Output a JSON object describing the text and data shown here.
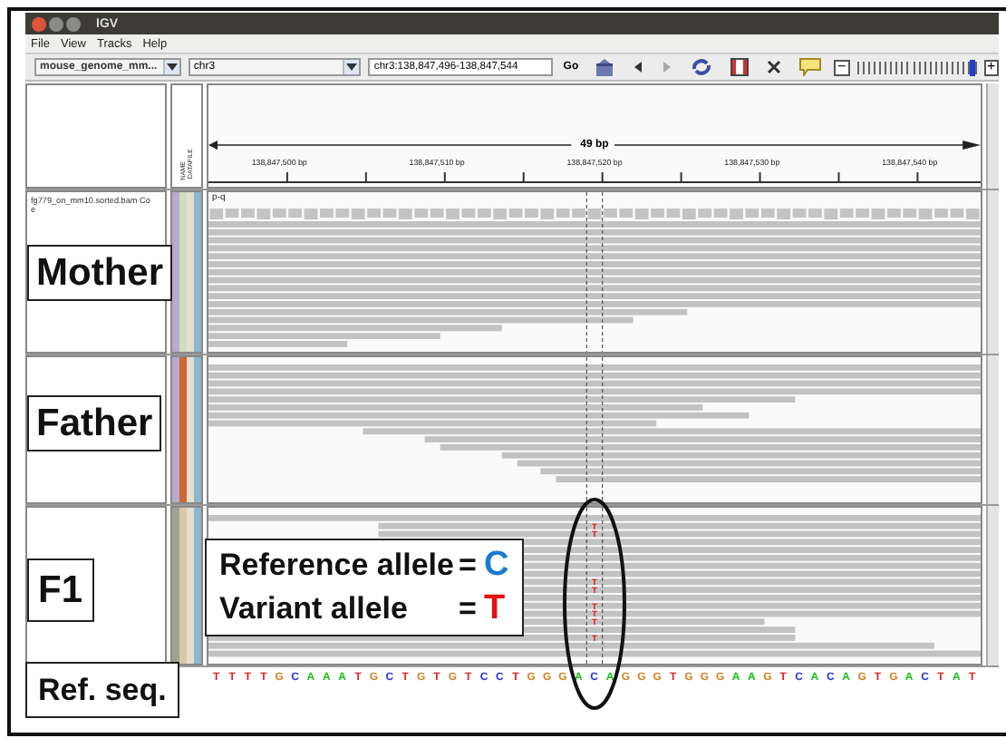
{
  "window": {
    "title": "IGV"
  },
  "menu": [
    "File",
    "View",
    "Tracks",
    "Help"
  ],
  "toolbar": {
    "genome": "mouse_genome_mm...",
    "chromosome": "chr3",
    "locus": "chr3:138,847,496-138,847,544",
    "go": "Go",
    "zoom": {
      "minus": "−",
      "plus": "+",
      "level": 0.97
    }
  },
  "ruler": {
    "span": "49 bp",
    "ticks": [
      "138,847,500 bp",
      "138,847,510 bp",
      "138,847,520 bp",
      "138,847,530 bp",
      "138,847,540 bp"
    ]
  },
  "attribute_headers": [
    "NAME",
    "DATAFILE"
  ],
  "panels": [
    {
      "kind": "mother",
      "label": "Mother",
      "track_name": "fg779_on_mm10.sorted.bam Co",
      "track_name_line_2": "e",
      "band": "p-q",
      "attributes": [
        {
          "color": "#b7a9cf"
        },
        {
          "color": "#cfdcbf"
        },
        {
          "color": "#e6dfcf"
        },
        {
          "color": "#8db7cb"
        }
      ]
    },
    {
      "kind": "father",
      "label": "Father",
      "attributes": [
        {
          "color": "#b7a9cf"
        },
        {
          "color": "#cc6633"
        },
        {
          "color": "#e6dfcf"
        },
        {
          "color": "#8db7cb"
        }
      ]
    },
    {
      "kind": "f1",
      "label": "F1",
      "attributes": [
        {
          "color": "#9ea293"
        },
        {
          "color": "#d9c8a6"
        },
        {
          "color": "#e6dfcf"
        },
        {
          "color": "#8db7cb"
        }
      ],
      "mismatches": [
        "T",
        "T",
        "T",
        "T",
        "T",
        "T",
        "T",
        "T"
      ]
    }
  ],
  "legend": [
    {
      "label": "Reference allele",
      "equals": "=",
      "base": "C",
      "color": "#1a7bd0"
    },
    {
      "label": "Variant allele",
      "equals": "=",
      "base": "T",
      "color": "#e81010"
    }
  ],
  "reference": {
    "label": "Ref. seq.",
    "bases": [
      {
        "base": "T",
        "color": "#e02020"
      },
      {
        "base": "T",
        "color": "#e02020"
      },
      {
        "base": "T",
        "color": "#e02020"
      },
      {
        "base": "T",
        "color": "#e02020"
      },
      {
        "base": "G",
        "color": "#d08020"
      },
      {
        "base": "C",
        "color": "#2030e0"
      },
      {
        "base": "A",
        "color": "#20c020"
      },
      {
        "base": "A",
        "color": "#20c020"
      },
      {
        "base": "A",
        "color": "#20c020"
      },
      {
        "base": "T",
        "color": "#e02020"
      },
      {
        "base": "G",
        "color": "#d08020"
      },
      {
        "base": "C",
        "color": "#2030e0"
      },
      {
        "base": "T",
        "color": "#e02020"
      },
      {
        "base": "G",
        "color": "#d08020"
      },
      {
        "base": "T",
        "color": "#e02020"
      },
      {
        "base": "G",
        "color": "#d08020"
      },
      {
        "base": "T",
        "color": "#e02020"
      },
      {
        "base": "C",
        "color": "#2030e0"
      },
      {
        "base": "C",
        "color": "#2030e0"
      },
      {
        "base": "T",
        "color": "#e02020"
      },
      {
        "base": "G",
        "color": "#d08020"
      },
      {
        "base": "G",
        "color": "#d08020"
      },
      {
        "base": "G",
        "color": "#d08020"
      },
      {
        "base": "A",
        "color": "#20c020"
      },
      {
        "base": "C",
        "color": "#2030e0"
      },
      {
        "base": "A",
        "color": "#20c020"
      },
      {
        "base": "G",
        "color": "#d08020"
      },
      {
        "base": "G",
        "color": "#d08020"
      },
      {
        "base": "G",
        "color": "#d08020"
      },
      {
        "base": "T",
        "color": "#e02020"
      },
      {
        "base": "G",
        "color": "#d08020"
      },
      {
        "base": "G",
        "color": "#d08020"
      },
      {
        "base": "G",
        "color": "#d08020"
      },
      {
        "base": "A",
        "color": "#20c020"
      },
      {
        "base": "A",
        "color": "#20c020"
      },
      {
        "base": "G",
        "color": "#d08020"
      },
      {
        "base": "T",
        "color": "#e02020"
      },
      {
        "base": "C",
        "color": "#2030e0"
      },
      {
        "base": "A",
        "color": "#20c020"
      },
      {
        "base": "C",
        "color": "#2030e0"
      },
      {
        "base": "A",
        "color": "#20c020"
      },
      {
        "base": "G",
        "color": "#d08020"
      },
      {
        "base": "T",
        "color": "#e02020"
      },
      {
        "base": "G",
        "color": "#d08020"
      },
      {
        "base": "A",
        "color": "#20c020"
      },
      {
        "base": "C",
        "color": "#2030e0"
      },
      {
        "base": "T",
        "color": "#e02020"
      },
      {
        "base": "A",
        "color": "#20c020"
      },
      {
        "base": "T",
        "color": "#e02020"
      }
    ]
  }
}
